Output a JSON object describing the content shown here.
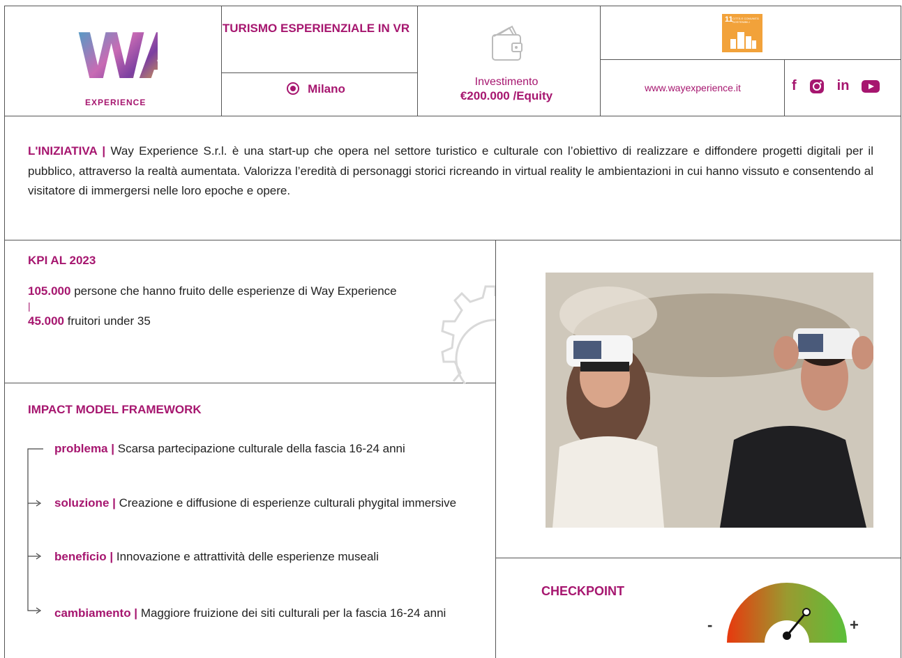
{
  "header": {
    "logo_text": "WAY",
    "logo_subtitle": "EXPERIENCE",
    "title": "TURISMO ESPERIENZIALE IN VR",
    "city": "Milano",
    "investment_label": "Investimento",
    "investment_value": "€200.000 /Equity",
    "sdg_number": "11",
    "sdg_text": "CITTÀ E COMUNITÀ SOSTENIBILI",
    "website": "www.wayexperience.it",
    "social": [
      "f",
      "instagram",
      "in",
      "youtube"
    ]
  },
  "initiative": {
    "label": "L'INIZIATIVA |",
    "text": "Way Experience S.r.l. è una start-up che opera nel settore turistico e culturale con l’obiettivo di realizzare e diffondere progetti digitali per il pubblico, attraverso la realtà aumentata. Valorizza l’eredità di personaggi storici ricreando in virtual reality le ambientazioni in cui hanno vissuto e consentendo al visitatore di immergersi nelle loro epoche e opere."
  },
  "kpi": {
    "title": "KPI AL 2023",
    "items": [
      {
        "value": "105.000",
        "text": "persone che hanno fruito delle esperienze di Way Experience"
      },
      {
        "value": "45.000",
        "text": "fruitori under 35"
      }
    ],
    "separator": "|"
  },
  "impact_model": {
    "title": "IMPACT MODEL FRAMEWORK",
    "items": [
      {
        "label": "problema |",
        "text": "Scarsa partecipazione culturale della fascia 16-24 anni"
      },
      {
        "label": "soluzione |",
        "text": "Creazione e diffusione di esperienze culturali phygital immersive"
      },
      {
        "label": "beneficio |",
        "text": "Innovazione e attrattività delle esperienze museali"
      },
      {
        "label": "cambiamento |",
        "text": "Maggiore fruizione dei siti culturali per la fascia 16-24 anni"
      }
    ]
  },
  "checkpoint": {
    "title": "CHECKPOINT",
    "minus": "-",
    "plus": "+",
    "gauge_level": 0.72
  },
  "colors": {
    "accent": "#a6166f",
    "sdg_orange": "#f2a23a",
    "gauge_low": "#e8390e",
    "gauge_high": "#5bbf3a"
  }
}
